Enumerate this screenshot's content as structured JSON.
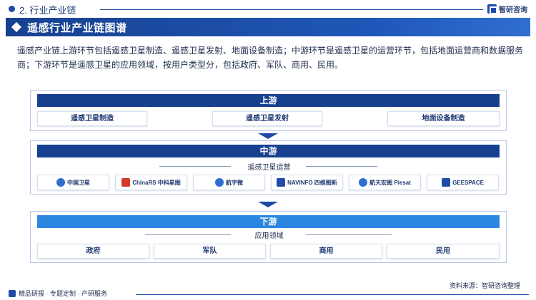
{
  "header": {
    "section_title": "2. 行业产业链",
    "logo_text": "智研咨询"
  },
  "banner": {
    "title": "遥感行业产业链图谱"
  },
  "intro": {
    "text": "遥感产业链上游环节包括遥感卫星制造、遥感卫星发射、地面设备制造；中游环节是遥感卫星的运营环节，包括地面运营商和数据服务商；下游环节是遥感卫星的应用领域，按用户类型分，包括政府、军队、商用、民用。"
  },
  "upstream": {
    "header": "上游",
    "items": [
      "遥感卫星制造",
      "遥感卫星发射",
      "地面设备制造"
    ]
  },
  "midstream": {
    "header": "中游",
    "label": "遥感卫星运营",
    "companies": [
      "中国卫星",
      "ChinaRS 中科星图",
      "航宇微",
      "NAVINFO 四维图新",
      "航天宏图 Piesat",
      "GEESPACE"
    ]
  },
  "downstream": {
    "header": "下游",
    "label": "应用领域",
    "items": [
      "政府",
      "军队",
      "商用",
      "民用"
    ]
  },
  "footer": {
    "left_text": "精品研报 · 专题定制 · 产研服务",
    "source": "资料来源：智研咨询整理"
  },
  "colors": {
    "primary": "#17418f",
    "accent": "#2b86e0"
  }
}
